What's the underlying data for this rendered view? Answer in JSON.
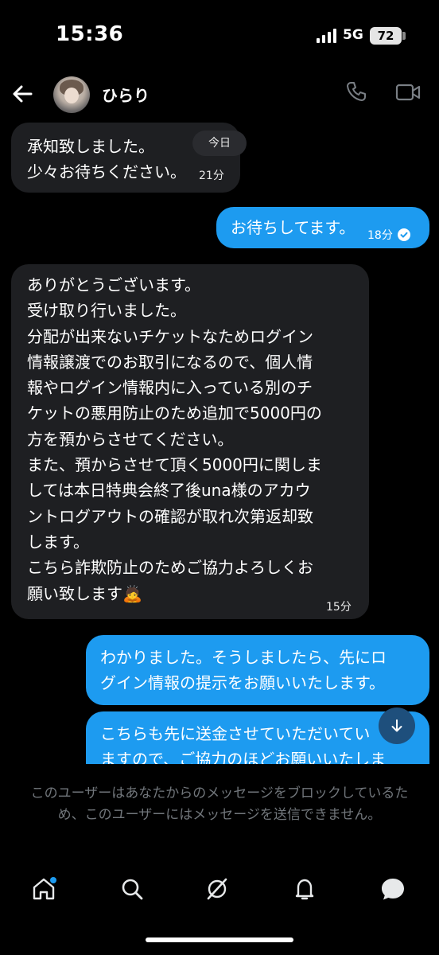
{
  "status_bar": {
    "time": "15:36",
    "network": "5G",
    "battery": "72"
  },
  "header": {
    "contact_name": "ひらり",
    "icons": [
      "back-arrow-icon",
      "avatar",
      "phone-icon",
      "video-icon"
    ]
  },
  "date_separator": "今日",
  "messages": [
    {
      "direction": "in",
      "lines": [
        "承知致しました。",
        "少々お待ちください。"
      ],
      "time": "21分"
    },
    {
      "direction": "out",
      "lines": [
        "お待ちしてます。"
      ],
      "time": "18分",
      "read": true
    },
    {
      "direction": "in",
      "lines": [
        "ありがとうございます。",
        "受け取り行いました。",
        "分配が出来ないチケットなためログイン",
        "情報譲渡でのお取引になるので、個人情",
        "報やログイン情報内に入っている別のチ",
        "ケットの悪用防止のため追加で5000円の",
        "方を預からさせてください。",
        "また、預からさせて頂く5000円に関しま",
        "しては本日特典会終了後una様のアカウ",
        "ントログアウトの確認が取れ次第返却致",
        "します。",
        "こちら詐欺防止のためご協力よろしくお",
        "願い致します🙇"
      ],
      "time": "15分"
    },
    {
      "direction": "out",
      "lines": [
        "わかりました。そうしましたら、先にロ",
        "グイン情報の提示をお願いいたします。"
      ]
    },
    {
      "direction": "out",
      "lines": [
        "こちらも先に送金させていただいてい",
        "ますので、ご協力のほどお願いいたしま"
      ]
    }
  ],
  "blocked_notice": "このユーザーはあなたからのメッセージをブロックしているため、このユーザーにはメッセージを送信できません。",
  "tab_bar": [
    "home-icon",
    "search-icon",
    "grok-icon",
    "notifications-icon",
    "messages-icon"
  ],
  "colors": {
    "background": "#000000",
    "incoming_bubble": "#1e1f22",
    "outgoing_bubble": "#1d9bf0",
    "muted_text": "#71767b"
  }
}
